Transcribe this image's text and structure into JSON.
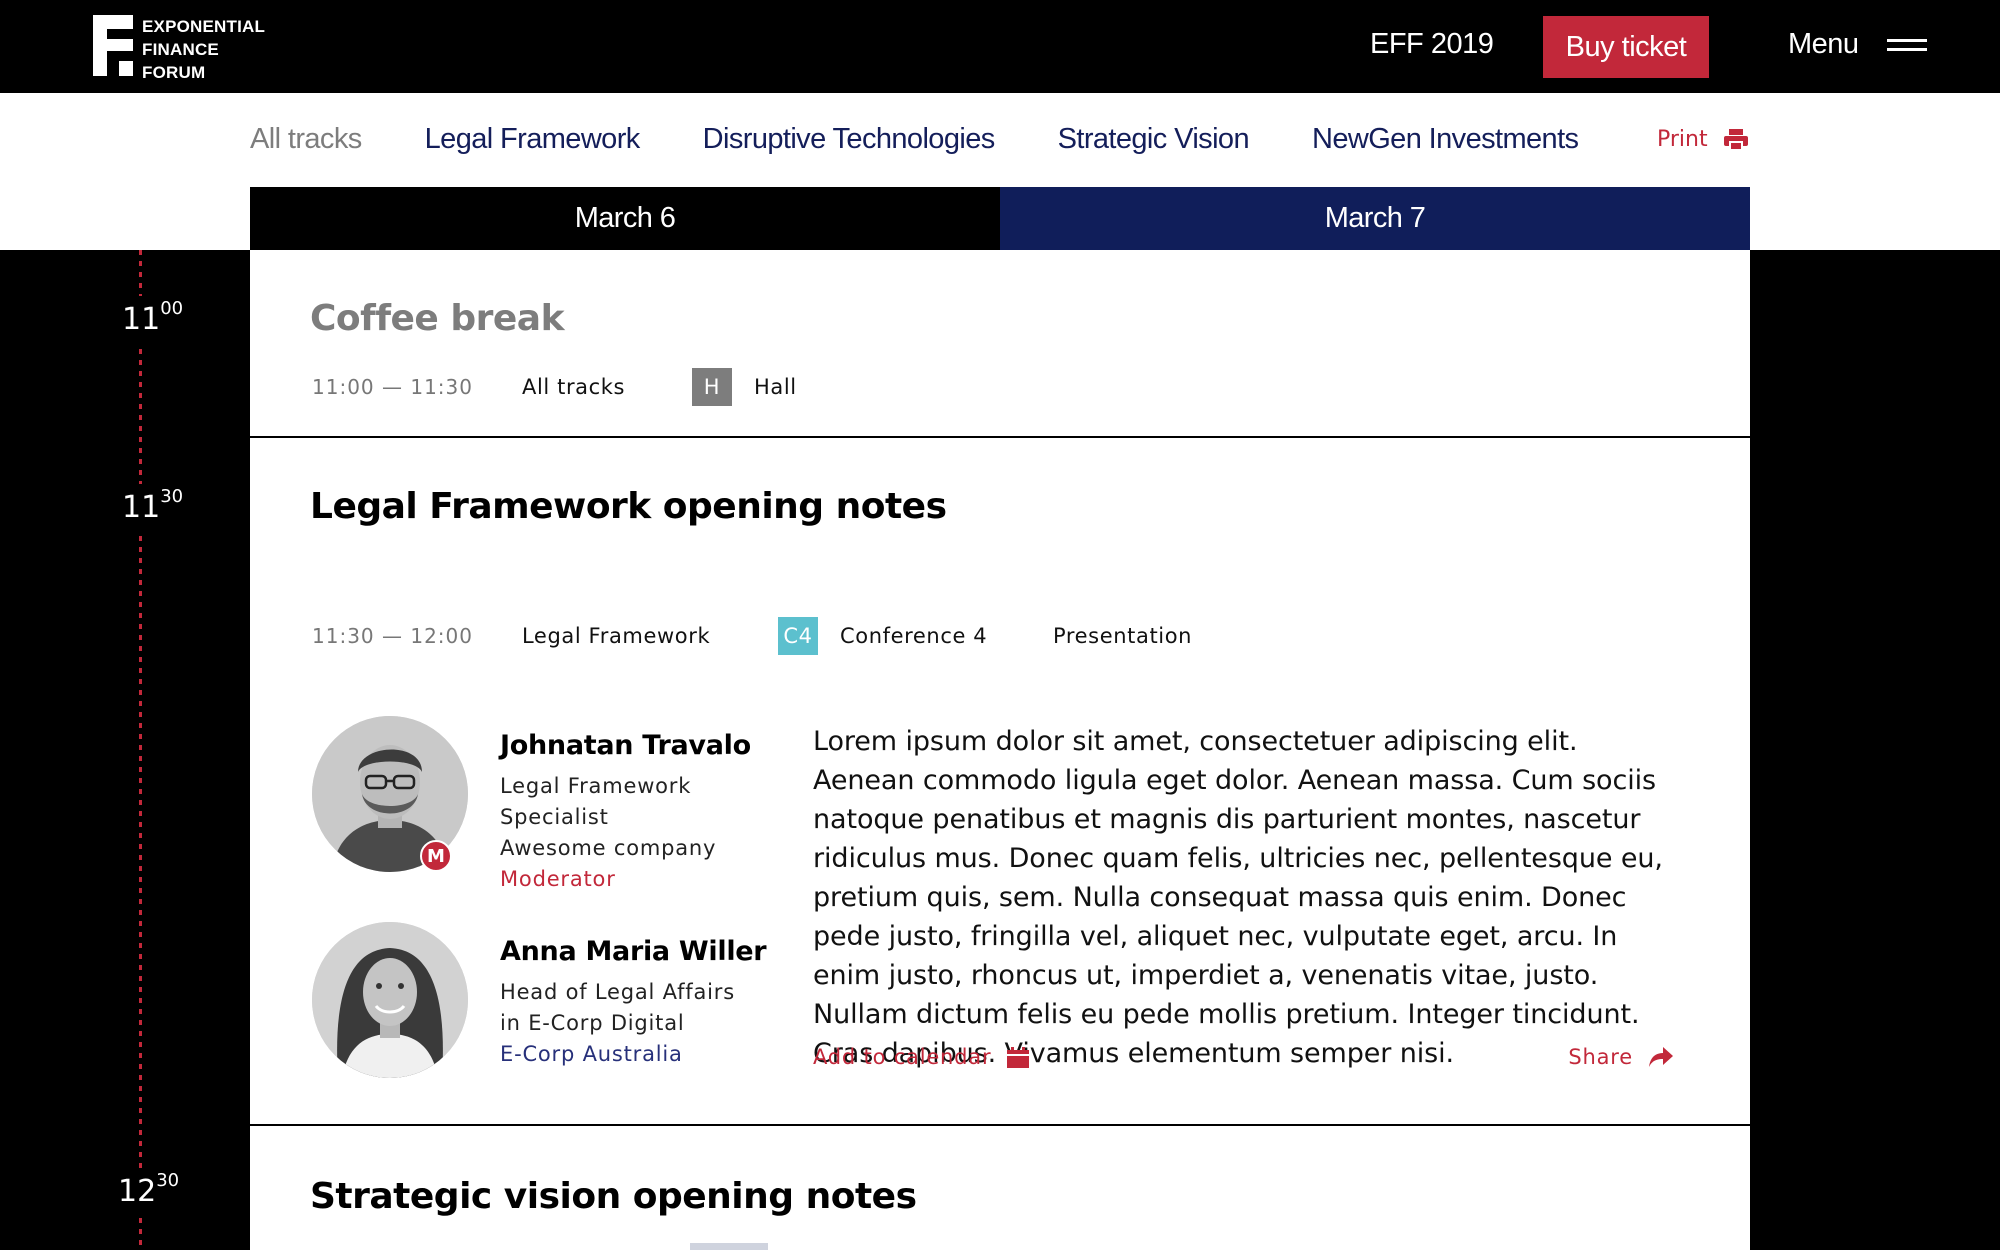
{
  "header": {
    "logo_lines": [
      "EXPONENTIAL",
      "FINANCE",
      "FORUM"
    ],
    "edition": "EFF 2019",
    "buy_label": "Buy ticket",
    "menu_label": "Menu"
  },
  "tracks": {
    "items": [
      "All tracks",
      "Legal Framework",
      "Disruptive Technologies",
      "Strategic Vision",
      "NewGen Investments"
    ],
    "print_label": "Print"
  },
  "days": [
    "March 6",
    "March 7"
  ],
  "timeline": [
    {
      "hour": "11",
      "minutes": "00"
    },
    {
      "hour": "11",
      "minutes": "30"
    },
    {
      "hour": "12",
      "minutes": "30"
    }
  ],
  "events": [
    {
      "title": "Coffee break",
      "time": "11:00 — 11:30",
      "track": "All tracks",
      "room_code": "H",
      "room_name": "Hall"
    },
    {
      "title": "Legal Framework opening notes",
      "time": "11:30 — 12:00",
      "track": "Legal Framework",
      "room_code": "C4",
      "room_name": "Conference 4",
      "format": "Presentation",
      "speakers": [
        {
          "name": "Johnatan Travalo",
          "line1": "Legal Framework",
          "line2": "Specialist",
          "line3": "Awesome company",
          "role": "Moderator",
          "badge": "M"
        },
        {
          "name": "Anna Maria Willer",
          "line1": "Head of Legal Affairs",
          "line2": "in E-Corp Digital",
          "company": "E-Corp Australia"
        }
      ],
      "description": "Lorem ipsum dolor sit amet, consectetuer adipiscing elit. Aenean commodo ligula eget dolor. Aenean massa. Cum sociis natoque penatibus et magnis dis parturient montes, nascetur ridiculus mus. Donec quam felis, ultricies nec, pellentesque eu, pretium quis, sem. Nulla consequat massa quis enim. Donec pede justo, fringilla vel, aliquet nec, vulputate eget, arcu. In enim justo, rhoncus ut, imperdiet a, venenatis vitae, justo. Nullam dictum felis eu pede mollis pretium. Integer tincidunt. Cras dapibus. Vivamus elementum semper nisi.",
      "add_calendar_label": "Add to calendar",
      "share_label": "Share"
    },
    {
      "title": "Strategic vision opening notes"
    }
  ],
  "colors": {
    "accent_red": "#c2283a",
    "navy": "#101e5a",
    "room_h": "#7d7d7d",
    "room_c4": "#5cc0ce"
  }
}
